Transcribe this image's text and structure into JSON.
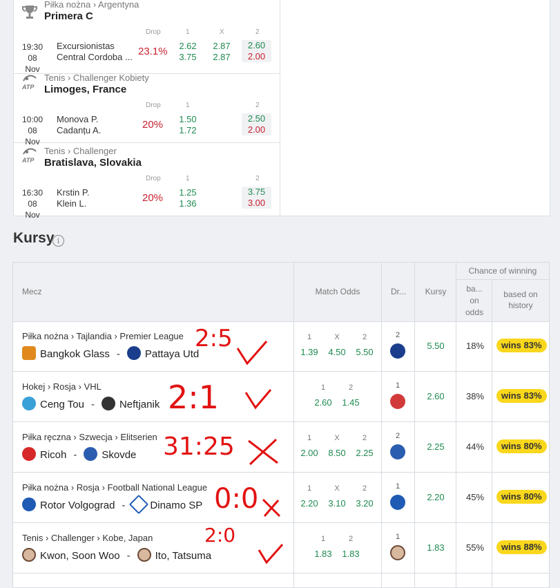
{
  "drops": [
    {
      "sport_icon": "trophy-icon",
      "path": "Piłka nożna › Argentyna",
      "league": "Primera C",
      "head_drop": "Drop",
      "head_1": "1",
      "head_x": "X",
      "head_2": "2",
      "time": "19:30",
      "date": "08 Nov",
      "home": "Excursionistas",
      "away": "Central Cordoba ...",
      "pct": "23.1%",
      "o1": [
        "2.62",
        "3.75"
      ],
      "ox": [
        "2.87",
        "2.87"
      ],
      "o2": [
        "2.60",
        "2.00"
      ]
    },
    {
      "sport_icon": "atp-tennis-icon",
      "path": "Tenis › Challenger Kobiety",
      "league": "Limoges, France",
      "head_drop": "Drop",
      "head_1": "1",
      "head_2": "2",
      "time": "10:00",
      "date": "08 Nov",
      "home": "Monova P.",
      "away": "Cadanțu A.",
      "pct": "20%",
      "o1": [
        "1.50",
        "1.72"
      ],
      "o2": [
        "2.50",
        "2.00"
      ]
    },
    {
      "sport_icon": "atp-tennis-icon",
      "path": "Tenis › Challenger",
      "league": "Bratislava, Slovakia",
      "head_drop": "Drop",
      "head_1": "1",
      "head_2": "2",
      "time": "16:30",
      "date": "08 Nov",
      "home": "Krstin P.",
      "away": "Klein L.",
      "pct": "20%",
      "o1": [
        "1.25",
        "1.36"
      ],
      "o2": [
        "3.75",
        "3.00"
      ]
    }
  ],
  "atp_label": "ATP",
  "kursy": {
    "title": "Kursy",
    "info": "i",
    "headers": {
      "mecz": "Mecz",
      "match_odds": "Match Odds",
      "drop": "Dr...",
      "kursy": "Kursy",
      "chance": "Chance of winning",
      "based_odds": "ba... on odds",
      "based_history": "based on history"
    },
    "rows": [
      {
        "path": "Piłka nożna › Tajlandia › Premier League",
        "home": "Bangkok Glass",
        "away": "Pattaya Utd",
        "labels": [
          "1",
          "X",
          "2"
        ],
        "odds": [
          "1.39",
          "4.50",
          "5.50"
        ],
        "drop": "2",
        "kurs": "5.50",
        "chance": "18%",
        "wins": "wins 83%",
        "home_color": "#e08a1e",
        "away_color": "#1a3e8c",
        "drop_color": "#1a3e8c"
      },
      {
        "path": "Hokej › Rosja › VHL",
        "home": "Ceng Tou",
        "away": "Neftjanik",
        "labels": [
          "1",
          "2"
        ],
        "odds": [
          "2.60",
          "1.45"
        ],
        "drop": "1",
        "kurs": "2.60",
        "chance": "38%",
        "wins": "wins 83%",
        "home_color": "#3aa0d8",
        "away_color": "#333333",
        "drop_color": "#d23a3a"
      },
      {
        "path": "Piłka ręczna › Szwecja › Elitserien",
        "home": "Ricoh",
        "away": "Skovde",
        "labels": [
          "1",
          "X",
          "2"
        ],
        "odds": [
          "2.00",
          "8.50",
          "2.25"
        ],
        "drop": "2",
        "kurs": "2.25",
        "chance": "44%",
        "wins": "wins 80%",
        "home_color": "#d62828",
        "away_color": "#2a5db0",
        "drop_color": "#2a5db0"
      },
      {
        "path": "Piłka nożna › Rosja › Football National League",
        "home": "Rotor Volgograd",
        "away": "Dinamo SP",
        "labels": [
          "1",
          "X",
          "2"
        ],
        "odds": [
          "2.20",
          "3.10",
          "3.20"
        ],
        "drop": "1",
        "kurs": "2.20",
        "chance": "45%",
        "wins": "wins 80%",
        "home_color": "#1f5bb5",
        "away_color": "#1f5bb5",
        "drop_color": "#1f5bb5"
      },
      {
        "path": "Tenis › Challenger › Kobe, Japan",
        "home": "Kwon, Soon Woo",
        "away": "Ito, Tatsuma",
        "labels": [
          "1",
          "2"
        ],
        "odds": [
          "1.83",
          "1.83"
        ],
        "drop": "1",
        "kurs": "1.83",
        "chance": "55%",
        "wins": "wins 88%",
        "home_color": "#6b4a36",
        "away_color": "#6b4a36",
        "drop_color": "#6b4a36"
      }
    ]
  },
  "annotations": [
    "2:5",
    "2:1",
    "31:25",
    "0:0",
    "2:0"
  ]
}
